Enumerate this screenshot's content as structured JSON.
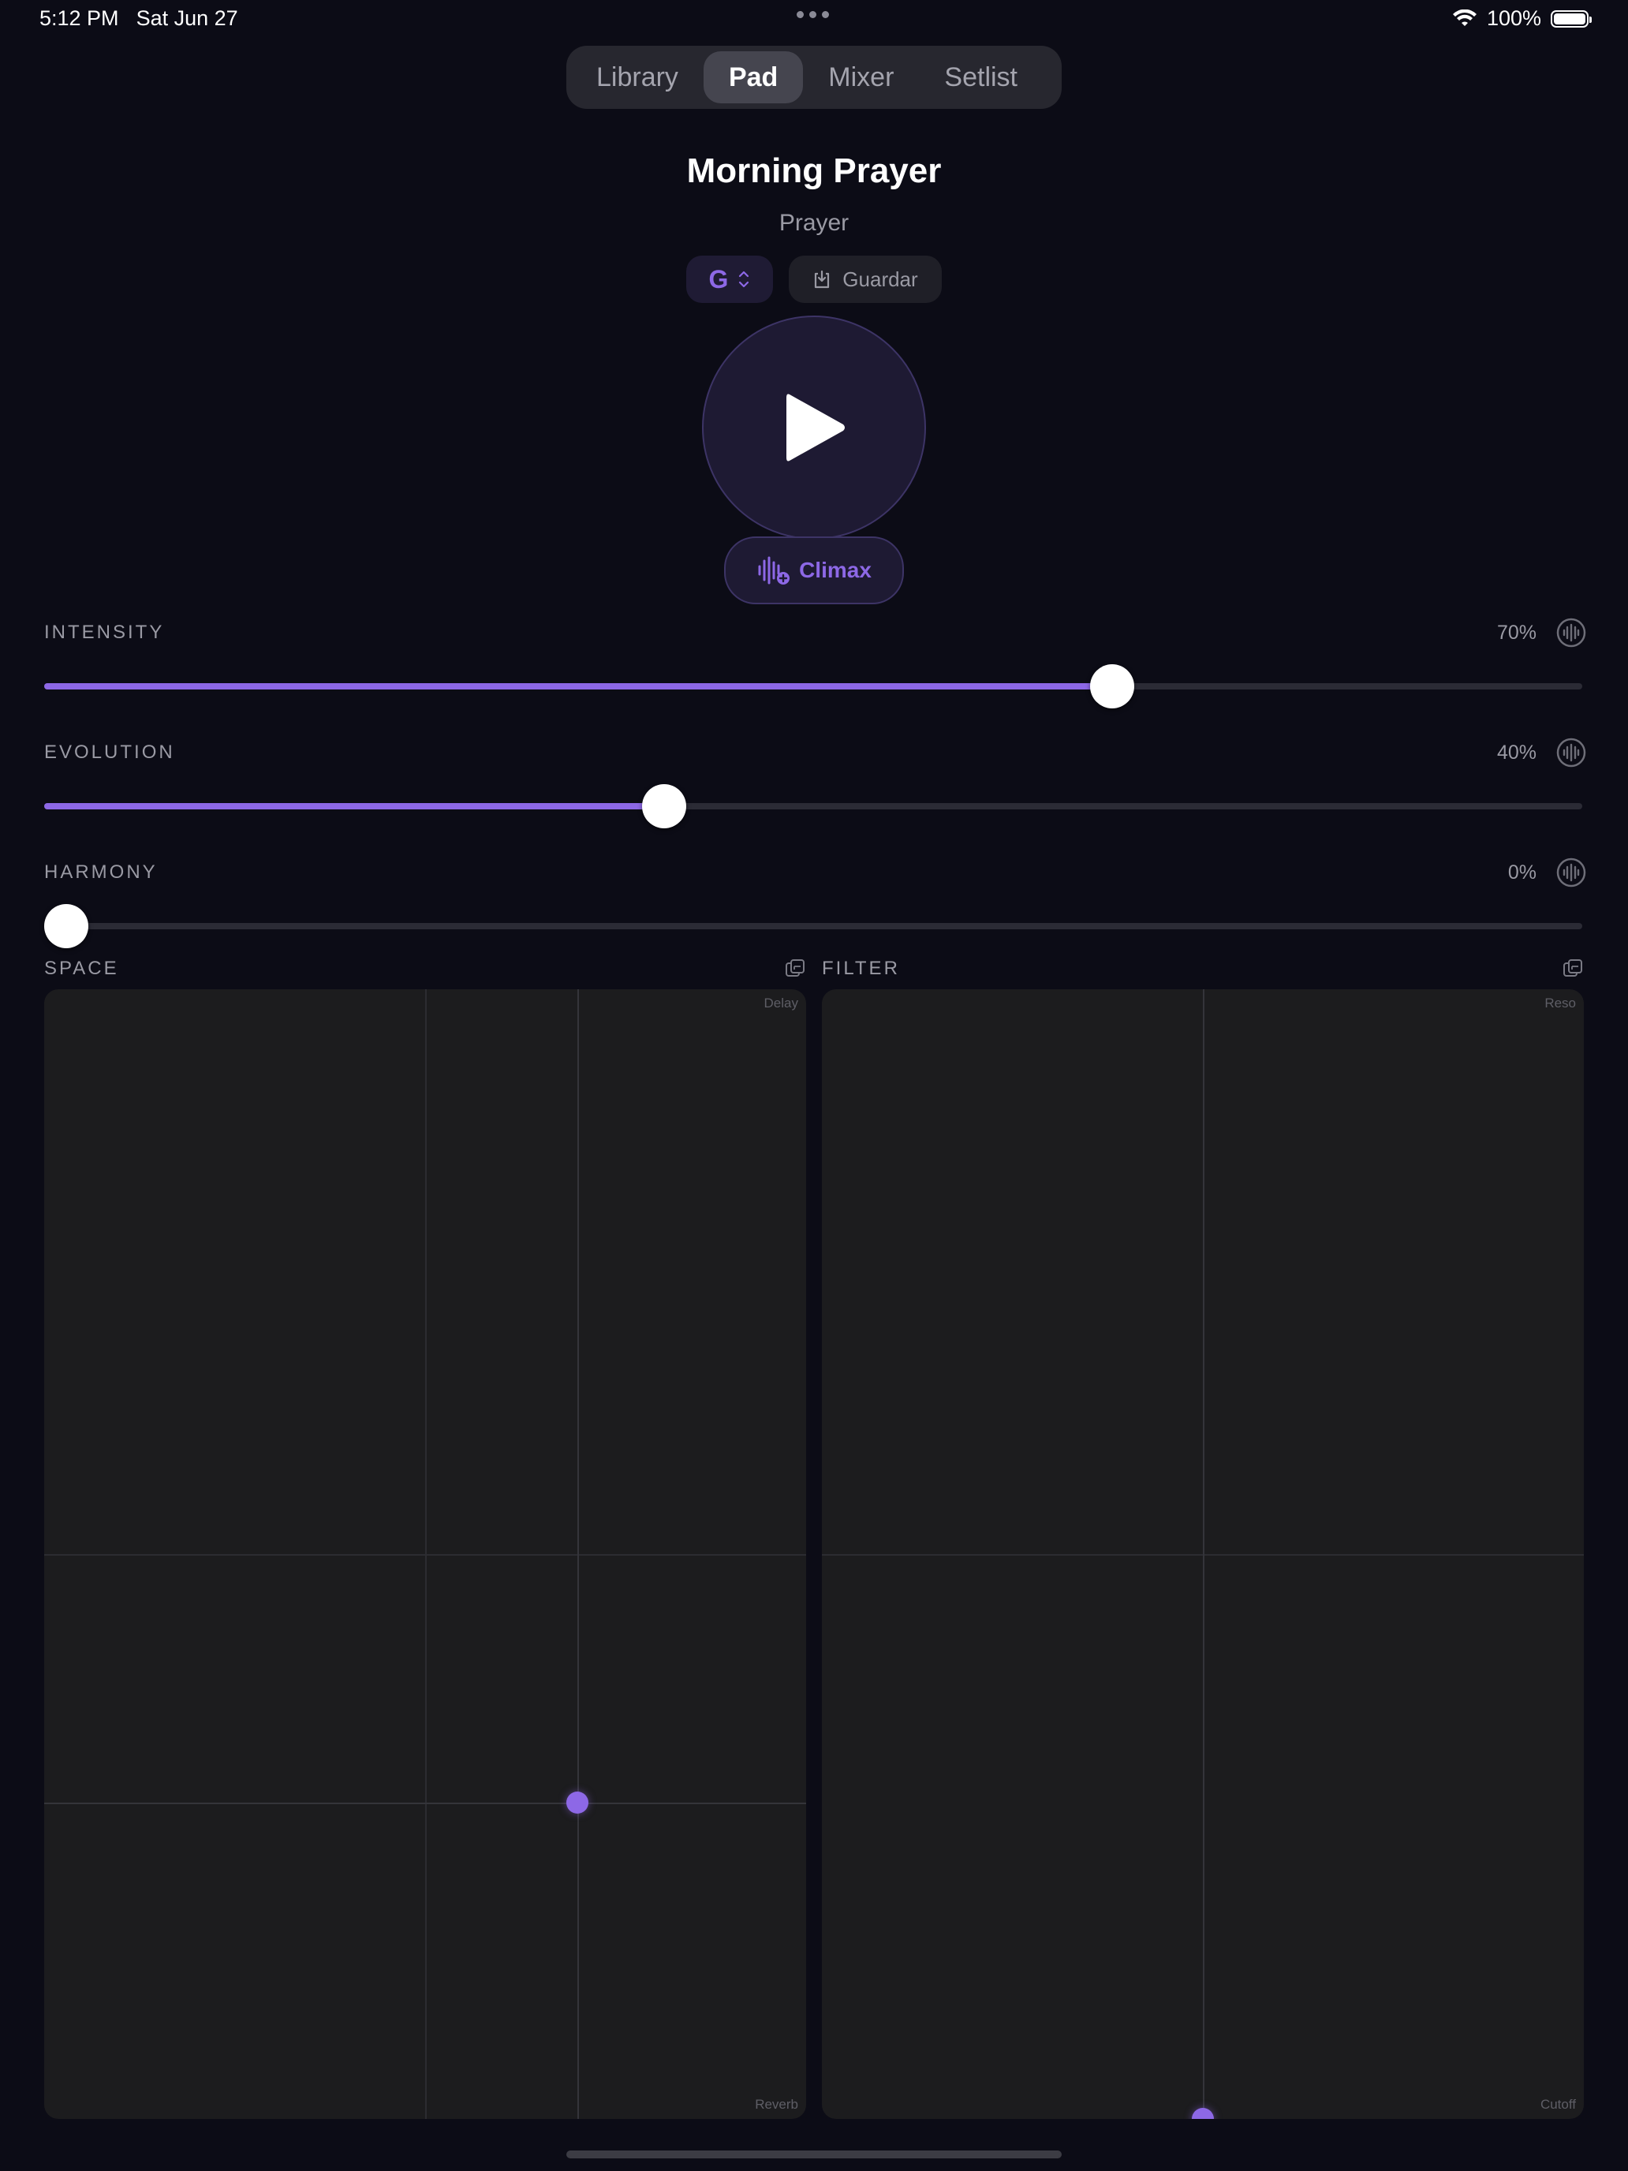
{
  "status_bar": {
    "time": "5:12 PM",
    "date": "Sat Jun 27",
    "battery": "100%"
  },
  "tabs": [
    {
      "label": "Library",
      "active": false
    },
    {
      "label": "Pad",
      "active": true
    },
    {
      "label": "Mixer",
      "active": false
    },
    {
      "label": "Setlist",
      "active": false
    }
  ],
  "preset": {
    "title": "Morning Prayer",
    "subtitle": "Prayer",
    "key": "G",
    "save_label": "Guardar",
    "climax_label": "Climax"
  },
  "sliders": [
    {
      "label": "INTENSITY",
      "value_text": "70%",
      "value": 0.7
    },
    {
      "label": "EVOLUTION",
      "value_text": "40%",
      "value": 0.4
    },
    {
      "label": "HARMONY",
      "value_text": "0%",
      "value": 0.0
    }
  ],
  "pads": {
    "space": {
      "label": "SPACE",
      "y_axis": "Delay",
      "x_axis": "Reverb",
      "x": 0.7,
      "y": 0.28
    },
    "filter": {
      "label": "FILTER",
      "y_axis": "Reso",
      "x_axis": "Cutoff",
      "x": 0.5,
      "y": 0.0
    }
  },
  "colors": {
    "accent": "#8d68e6",
    "background": "#0c0c16",
    "pad_bg": "#1c1c1e"
  },
  "icons": {
    "key_chevron": "chevron-up-down-icon",
    "save": "download-tray-icon",
    "play": "play-icon",
    "climax": "waveform-plus-icon",
    "modulation": "waveform-circle-icon",
    "pad_reset": "reset-square-icon"
  }
}
